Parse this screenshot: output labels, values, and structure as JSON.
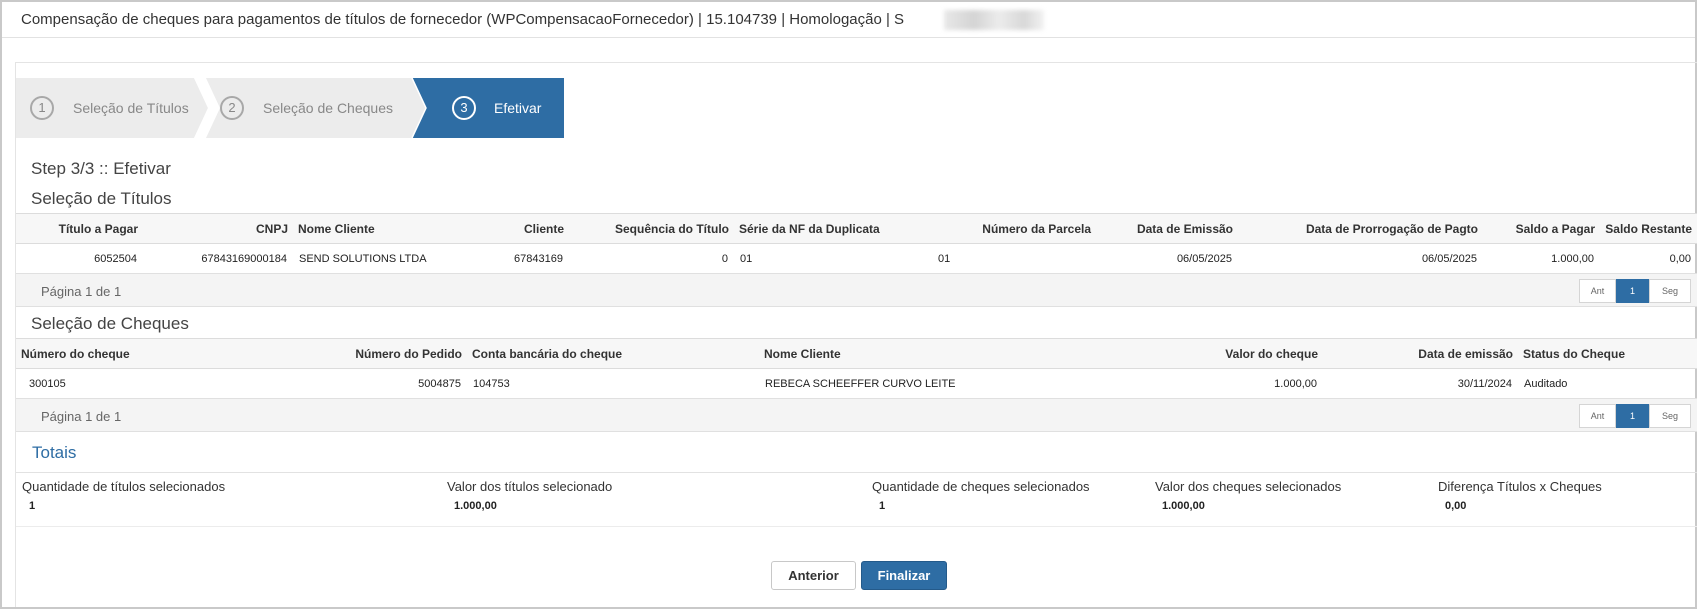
{
  "window": {
    "title": "Compensação de cheques para pagamentos de títulos de fornecedor (WPCompensacaoFornecedor) | 15.104739 | Homologação | S"
  },
  "wizard": {
    "steps": [
      {
        "number": "1",
        "label": "Seleção de Títulos"
      },
      {
        "number": "2",
        "label": "Seleção de Cheques"
      },
      {
        "number": "3",
        "label": "Efetivar"
      }
    ],
    "active_color": "#2e6da4",
    "inactive_color": "#ececec"
  },
  "step_heading": "Step 3/3 :: Efetivar",
  "titulos": {
    "heading": "Seleção de Títulos",
    "columns": [
      "Título a Pagar",
      "CNPJ",
      "Nome Cliente",
      "Cliente",
      "Sequência do Título",
      "Série da NF da Duplicata",
      "Número da Parcela",
      "Data de Emissão",
      "Data de Prorrogação de Pagto",
      "Saldo a Pagar",
      "Saldo Restante"
    ],
    "rows": [
      [
        "6052504",
        "67843169000184",
        "SEND SOLUTIONS LTDA",
        "67843169",
        "0",
        "01",
        "01",
        "06/05/2025",
        "06/05/2025",
        "1.000,00",
        "0,00"
      ]
    ],
    "pager": {
      "info": "Página 1 de 1",
      "prev": "Ant",
      "current": "1",
      "next": "Seg"
    }
  },
  "cheques": {
    "heading": "Seleção de Cheques",
    "columns": [
      "Número do cheque",
      "Número do Pedido",
      "Conta bancária do cheque",
      "Nome Cliente",
      "Valor do cheque",
      "Data de emissão",
      "Status do Cheque"
    ],
    "rows": [
      [
        "300105",
        "5004875",
        "104753",
        "REBECA SCHEEFFER CURVO LEITE",
        "1.000,00",
        "30/11/2024",
        "Auditado"
      ]
    ],
    "pager": {
      "info": "Página 1 de 1",
      "prev": "Ant",
      "current": "1",
      "next": "Seg"
    }
  },
  "totais": {
    "heading": "Totais",
    "items": [
      {
        "label": "Quantidade de títulos selecionados",
        "value": "1"
      },
      {
        "label": "Valor dos títulos selecionado",
        "value": "1.000,00"
      },
      {
        "label": "Quantidade de cheques selecionados",
        "value": "1"
      },
      {
        "label": "Valor dos cheques selecionados",
        "value": "1.000,00"
      },
      {
        "label": "Diferença Títulos x Cheques",
        "value": "0,00"
      }
    ]
  },
  "actions": {
    "previous_label": "Anterior",
    "finish_label": "Finalizar"
  }
}
